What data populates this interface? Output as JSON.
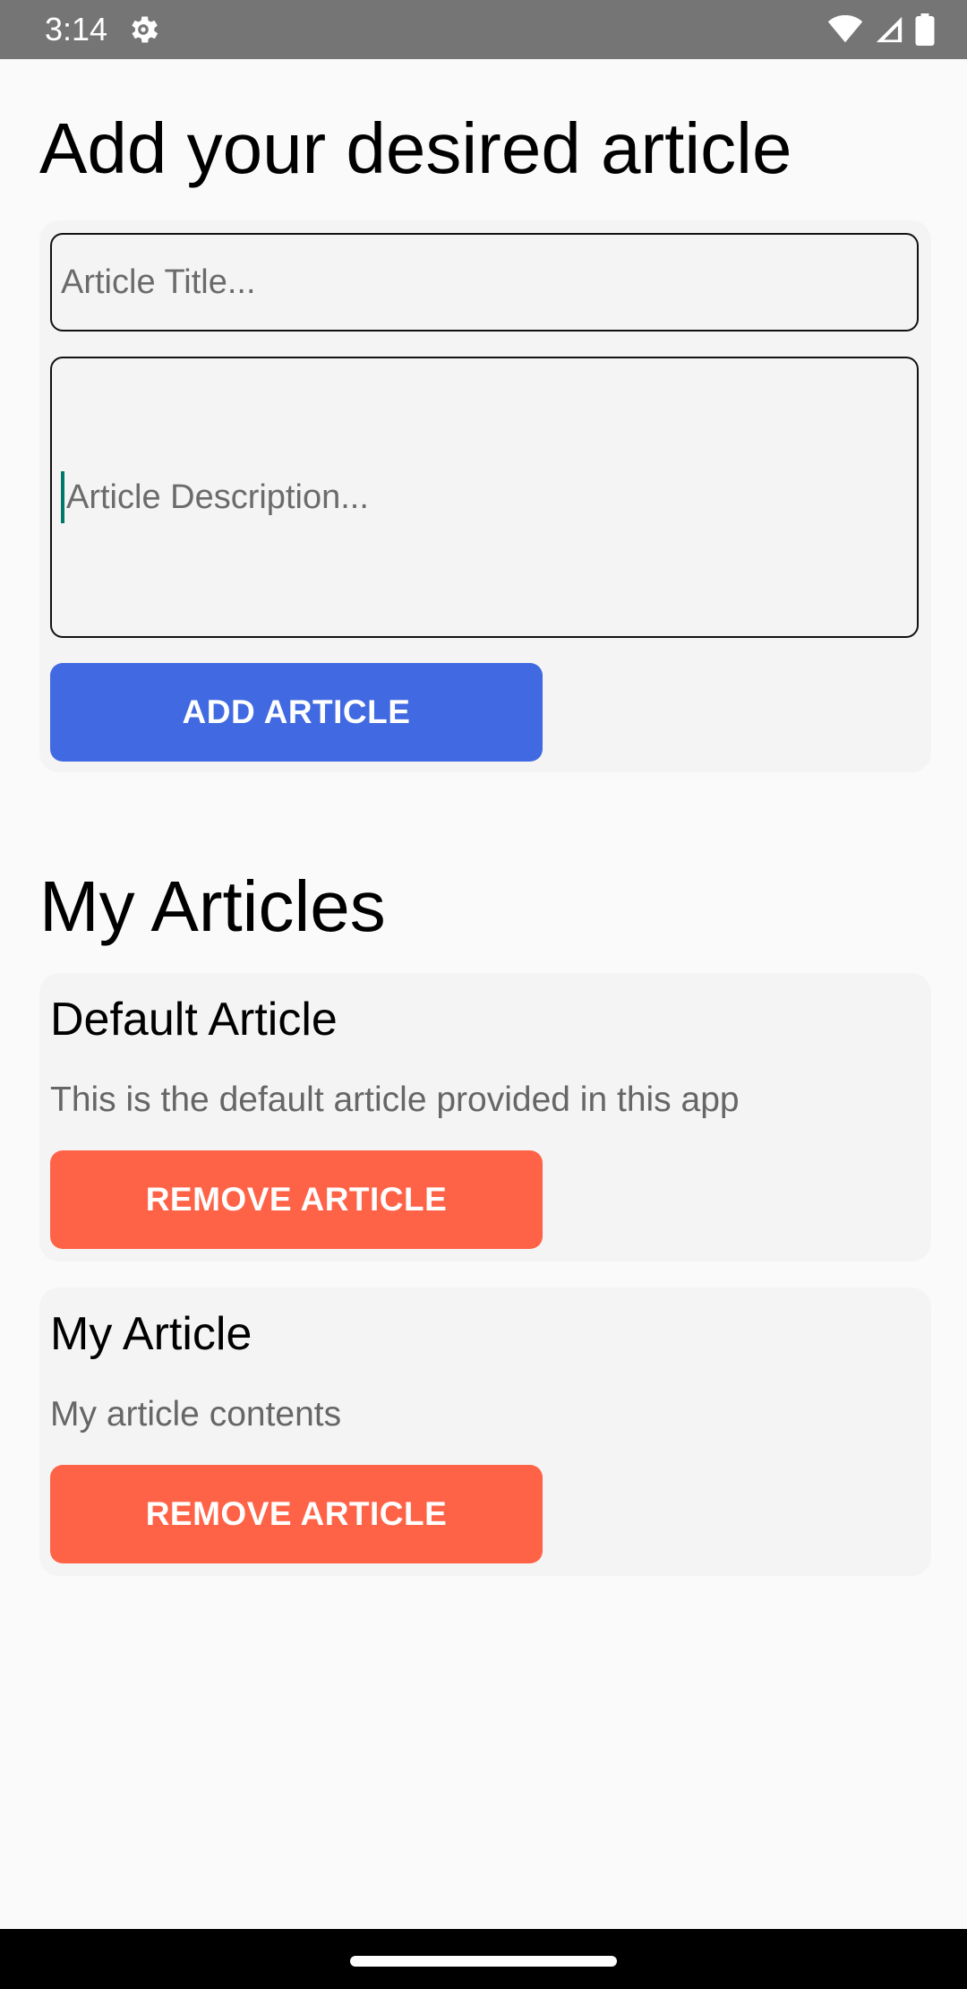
{
  "status_bar": {
    "time": "3:14",
    "icons": [
      "gear-icon",
      "wifi-icon",
      "signal-icon",
      "battery-icon"
    ]
  },
  "form": {
    "heading": "Add your desired article",
    "title_placeholder": "Article Title...",
    "description_placeholder": "Article Description...",
    "add_button_label": "ADD ARTICLE"
  },
  "articles_section": {
    "heading": "My Articles",
    "items": [
      {
        "title": "Default Article",
        "description": "This is the default article provided in this app",
        "remove_label": "REMOVE ARTICLE"
      },
      {
        "title": "My Article",
        "description": "My article contents",
        "remove_label": "REMOVE ARTICLE"
      }
    ]
  },
  "colors": {
    "add_button": "#4169e1",
    "remove_button": "#ff6347",
    "status_bar": "#757575",
    "caret": "#00796b"
  }
}
